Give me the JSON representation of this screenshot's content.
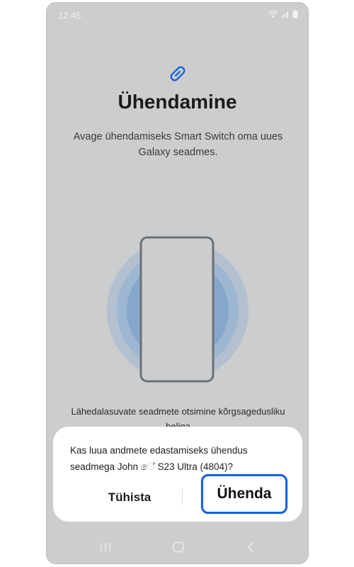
{
  "status_bar": {
    "time": "12:45"
  },
  "icons": {
    "link": "link-icon",
    "wifi": "wifi-icon",
    "signal": "signal-icon",
    "battery": "battery-icon",
    "recents": "recents-icon",
    "home": "home-icon",
    "back": "back-icon"
  },
  "colors": {
    "accent": "#1a63d8",
    "screen_bg": "#cccdcf",
    "ring_outer": "#b2c0cf",
    "ring_mid": "#9db6d2",
    "ring_inner": "#86a7cc"
  },
  "screen": {
    "title": "Ühendamine",
    "subtitle": "Avage ühendamiseks Smart Switch oma uues Galaxy seadmes.",
    "searching_text": "Lähedalasuvate seadmete otsimine kõrgsagedusliku heliga"
  },
  "dialog": {
    "message": "Kas luua andmete edastamiseks ühendus seadmega John ේ S23 Ultra (4804)?",
    "cancel_label": "Tühista",
    "confirm_label": "Ühenda"
  }
}
